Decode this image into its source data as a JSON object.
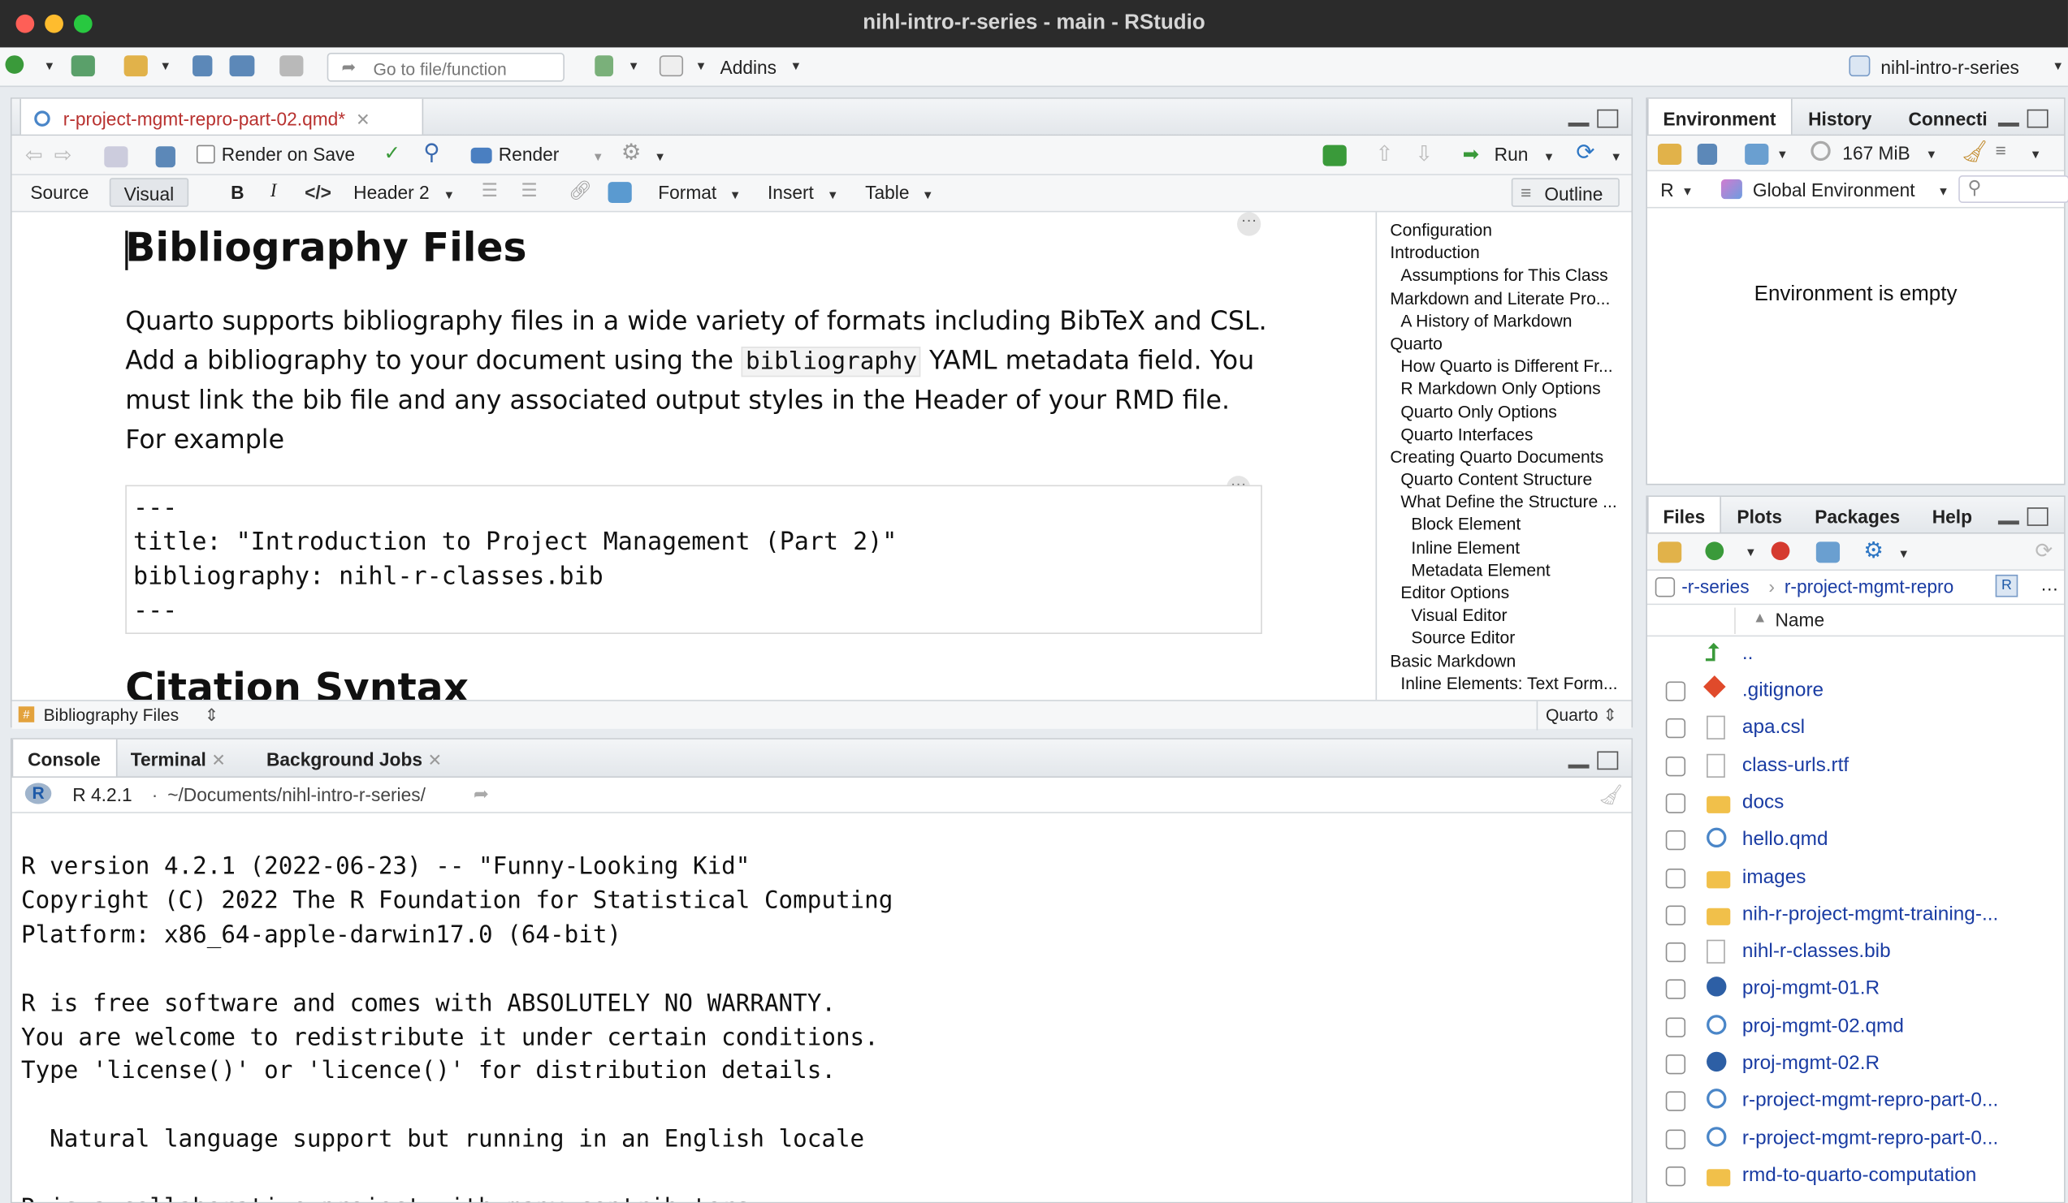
{
  "window": {
    "title": "nihl-intro-r-series - main - RStudio"
  },
  "toolbar": {
    "goto_placeholder": "Go to file/function",
    "addins_label": "Addins",
    "project_label": "nihl-intro-r-series"
  },
  "editor": {
    "tab_label": "r-project-mgmt-repro-part-02.qmd*",
    "render_on_save": "Render on Save",
    "render_label": "Render",
    "run_label": "Run",
    "source_tab": "Source",
    "visual_tab": "Visual",
    "header_select": "Header 2",
    "format_menu": "Format",
    "insert_menu": "Insert",
    "table_menu": "Table",
    "outline_btn": "Outline",
    "heading": "Bibliography Files",
    "para_1": "Quarto supports bibliography files in a wide variety of formats including BibTeX and CSL. Add a bibliography to your document using the ",
    "para_code": "bibliography",
    "para_2": " YAML metadata field. You must link the bib file and any associated output styles in the Header of your RMD file. For example",
    "code_lines": [
      "---",
      "title: \"Introduction to Project Management (Part 2)\"",
      "bibliography: nihl-r-classes.bib",
      "---"
    ],
    "next_heading": "Citation Syntax",
    "status_section": "Bibliography Files",
    "status_mode": "Quarto"
  },
  "outline": [
    {
      "label": "Configuration",
      "level": 0
    },
    {
      "label": "Introduction",
      "level": 0
    },
    {
      "label": "Assumptions for This Class",
      "level": 1
    },
    {
      "label": "Markdown and Literate Pro...",
      "level": 0
    },
    {
      "label": "A History of Markdown",
      "level": 1
    },
    {
      "label": "Quarto",
      "level": 0
    },
    {
      "label": "How Quarto is Different Fr...",
      "level": 1
    },
    {
      "label": "R Markdown Only Options",
      "level": 1
    },
    {
      "label": "Quarto Only Options",
      "level": 1
    },
    {
      "label": "Quarto Interfaces",
      "level": 1
    },
    {
      "label": "Creating Quarto Documents",
      "level": 0
    },
    {
      "label": "Quarto Content Structure",
      "level": 1
    },
    {
      "label": "What Define the Structure ...",
      "level": 1
    },
    {
      "label": "Block Element",
      "level": 2
    },
    {
      "label": "Inline Element",
      "level": 2
    },
    {
      "label": "Metadata Element",
      "level": 2
    },
    {
      "label": "Editor Options",
      "level": 1
    },
    {
      "label": "Visual Editor",
      "level": 2
    },
    {
      "label": "Source Editor",
      "level": 2
    },
    {
      "label": "Basic Markdown",
      "level": 0
    },
    {
      "label": "Inline Elements: Text Form...",
      "level": 1
    }
  ],
  "console": {
    "tabs": [
      "Console",
      "Terminal",
      "Background Jobs"
    ],
    "r_version": "R 4.2.1",
    "path": "~/Documents/nihl-intro-r-series/",
    "lines": [
      "R version 4.2.1 (2022-06-23) -- \"Funny-Looking Kid\"",
      "Copyright (C) 2022 The R Foundation for Statistical Computing",
      "Platform: x86_64-apple-darwin17.0 (64-bit)",
      "",
      "R is free software and comes with ABSOLUTELY NO WARRANTY.",
      "You are welcome to redistribute it under certain conditions.",
      "Type 'license()' or 'licence()' for distribution details.",
      "",
      "  Natural language support but running in an English locale",
      "",
      "R is a collaborative project with many contributors."
    ]
  },
  "environment": {
    "tabs": [
      "Environment",
      "History",
      "Connecti"
    ],
    "memory": "167 MiB",
    "language": "R",
    "scope": "Global Environment",
    "empty_msg": "Environment is empty"
  },
  "files": {
    "tabs": [
      "Files",
      "Plots",
      "Packages",
      "Help"
    ],
    "crumb_1": "-r-series",
    "crumb_2": "r-project-mgmt-repro",
    "name_header": "Name",
    "up": "..",
    "items": [
      {
        "name": ".gitignore",
        "icon": "git-icon"
      },
      {
        "name": "apa.csl",
        "icon": "doc-icon"
      },
      {
        "name": "class-urls.rtf",
        "icon": "doc-icon"
      },
      {
        "name": "docs",
        "icon": "folder-icon"
      },
      {
        "name": "hello.qmd",
        "icon": "quarto-icon"
      },
      {
        "name": "images",
        "icon": "folder-icon"
      },
      {
        "name": "nih-r-project-mgmt-training-...",
        "icon": "folder-icon"
      },
      {
        "name": "nihl-r-classes.bib",
        "icon": "doc-icon"
      },
      {
        "name": "proj-mgmt-01.R",
        "icon": "r-file-icon"
      },
      {
        "name": "proj-mgmt-02.qmd",
        "icon": "quarto-icon"
      },
      {
        "name": "proj-mgmt-02.R",
        "icon": "r-file-icon"
      },
      {
        "name": "r-project-mgmt-repro-part-0...",
        "icon": "quarto-icon"
      },
      {
        "name": "r-project-mgmt-repro-part-0...",
        "icon": "quarto-icon"
      },
      {
        "name": "rmd-to-quarto-computation",
        "icon": "folder-icon"
      }
    ]
  },
  "colors": {
    "link_blue": "#1a3ca3",
    "tab_red": "#b8312f",
    "folder": "#f1c04a"
  }
}
